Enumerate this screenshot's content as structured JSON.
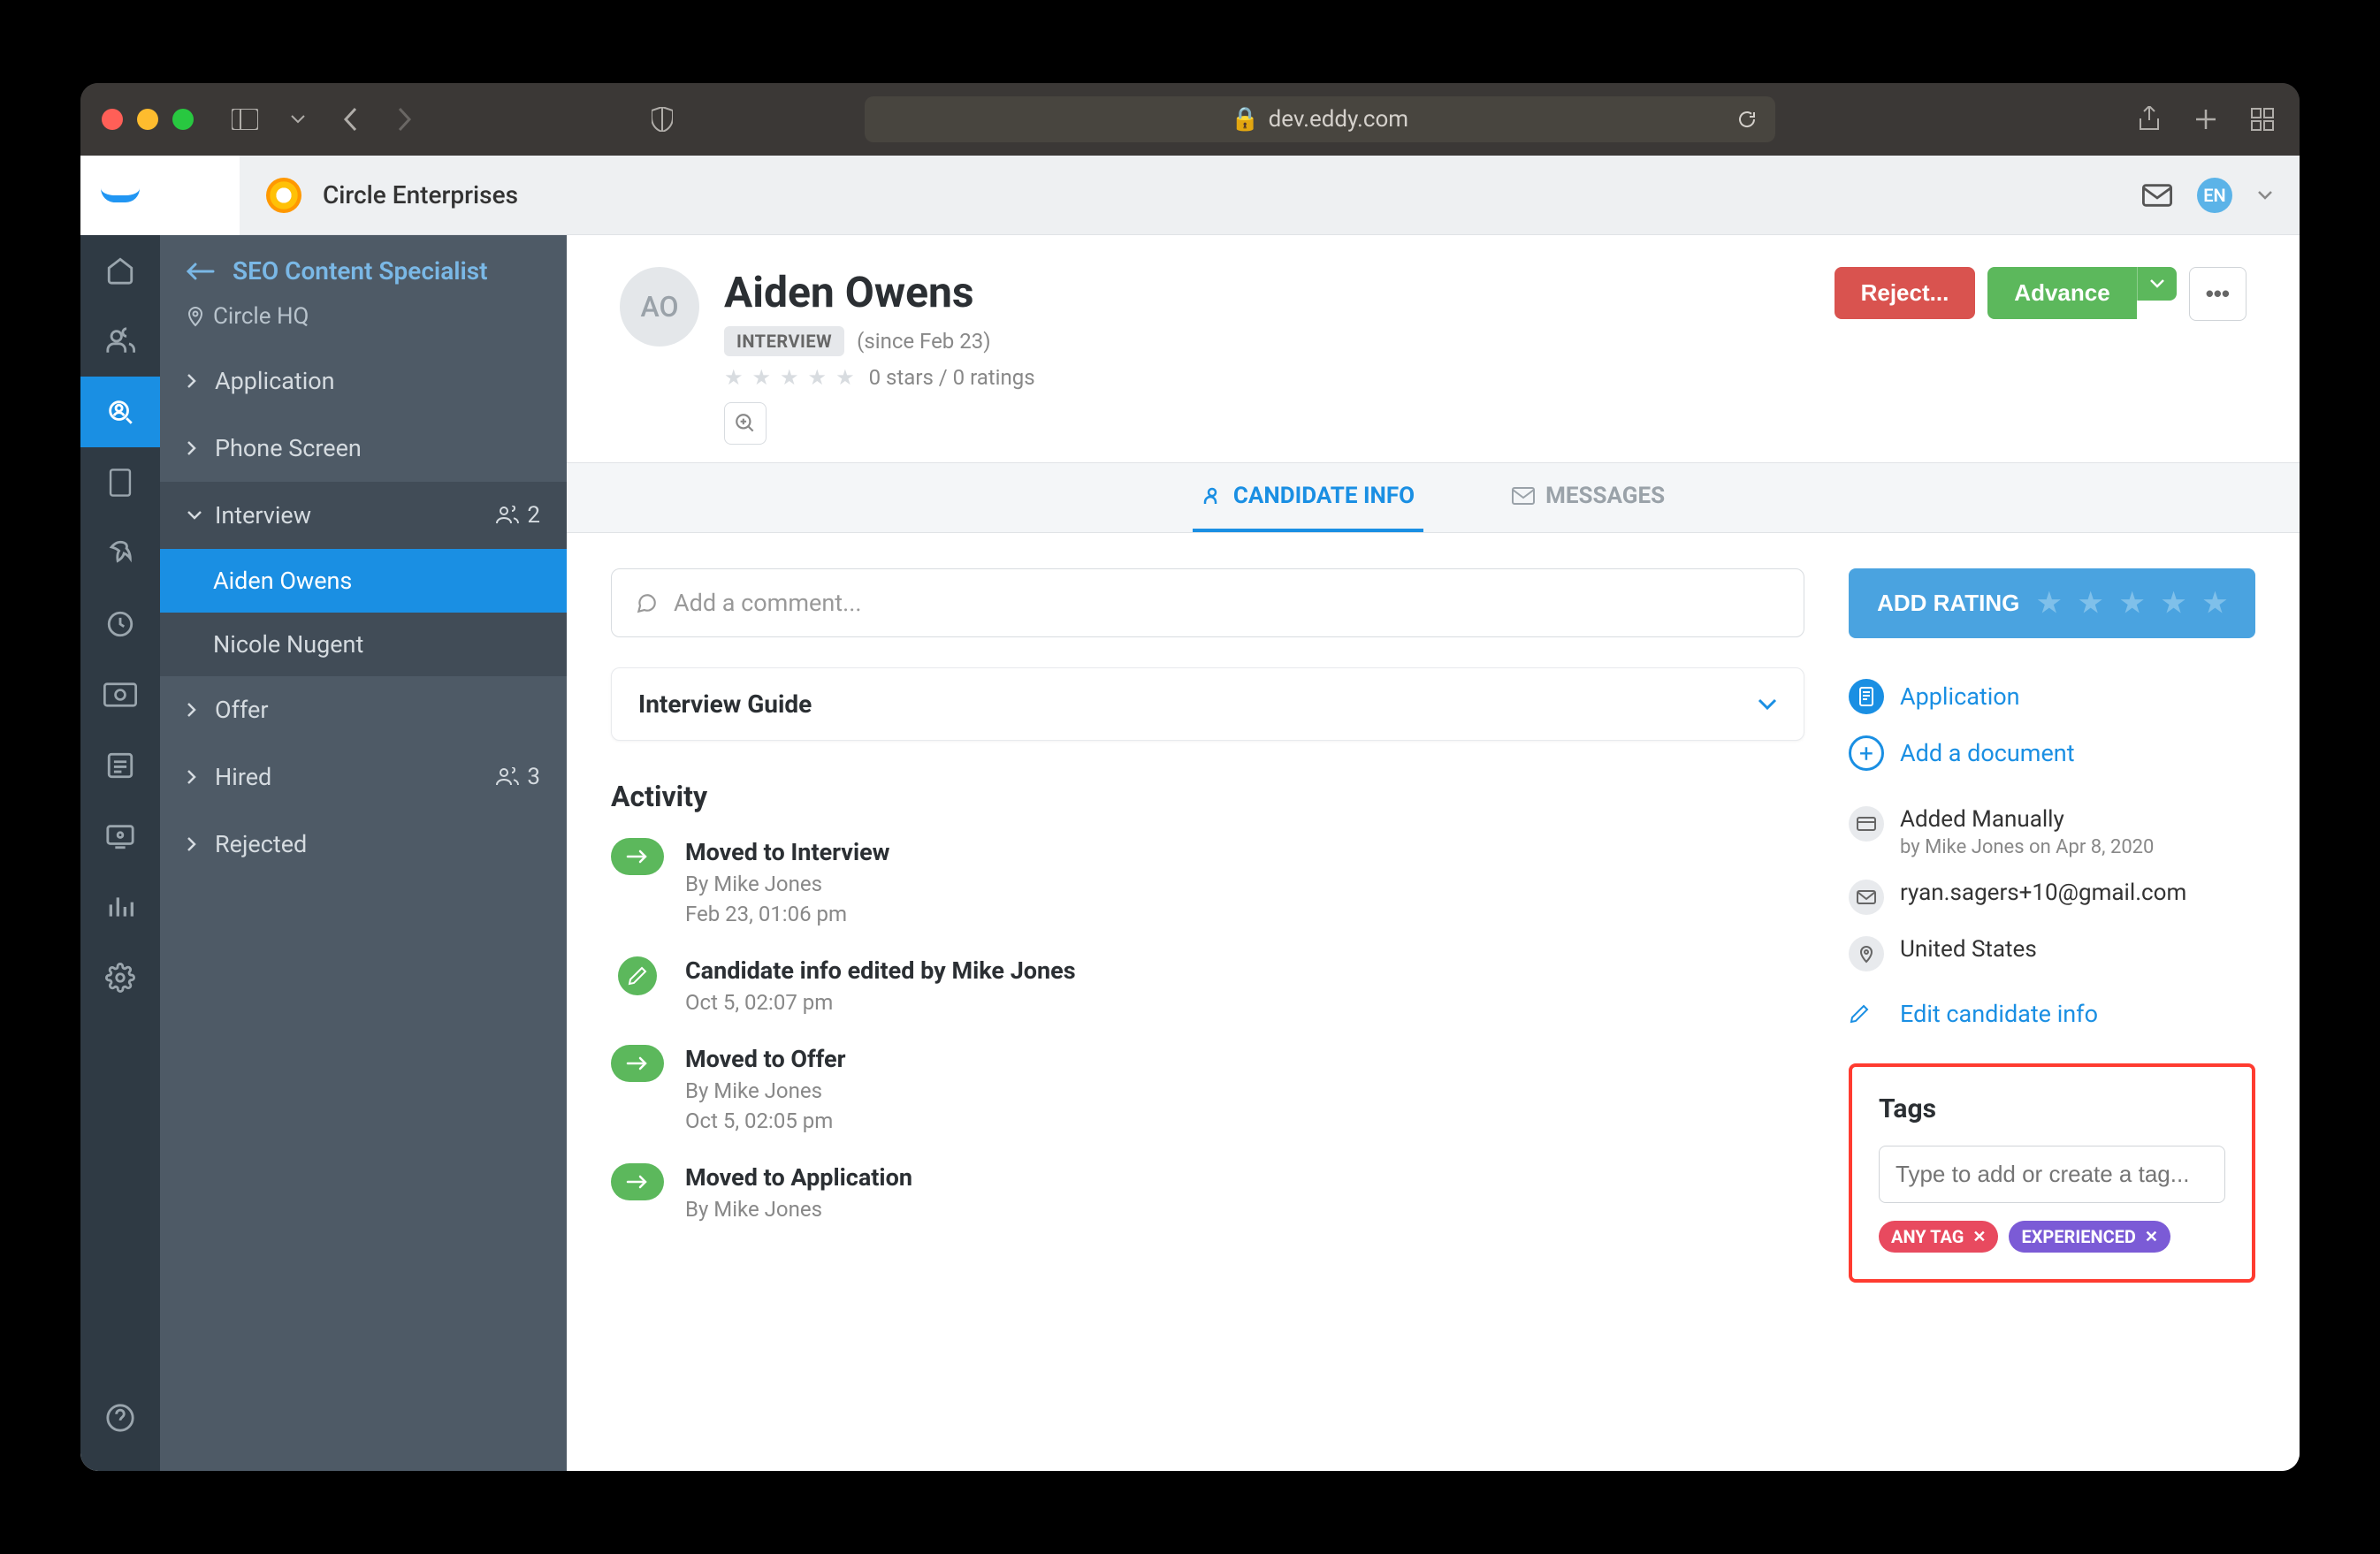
{
  "browser": {
    "url": "dev.eddy.com"
  },
  "topbar": {
    "org_name": "Circle Enterprises",
    "user_initials": "EN"
  },
  "sidepanel": {
    "title": "SEO Content Specialist",
    "location": "Circle HQ",
    "stages": {
      "application": "Application",
      "phone_screen": "Phone Screen",
      "interview": "Interview",
      "interview_count": "2",
      "offer": "Offer",
      "hired": "Hired",
      "hired_count": "3",
      "rejected": "Rejected"
    },
    "candidates": {
      "aiden": "Aiden Owens",
      "nicole": "Nicole Nugent"
    }
  },
  "profile": {
    "initials": "AO",
    "name": "Aiden Owens",
    "stage_badge": "INTERVIEW",
    "since": "(since Feb 23)",
    "rating_text": "0 stars / 0 ratings",
    "actions": {
      "reject": "Reject...",
      "advance": "Advance"
    }
  },
  "tabs": {
    "candidate_info": "CANDIDATE INFO",
    "messages": "MESSAGES"
  },
  "main": {
    "comment_placeholder": "Add a comment...",
    "interview_guide": "Interview Guide",
    "activity_title": "Activity",
    "activity": [
      {
        "title": "Moved to Interview",
        "by": "By Mike Jones",
        "time": "Feb 23, 01:06 pm",
        "icon": "arrow"
      },
      {
        "title": "Candidate info edited by Mike Jones",
        "by": "",
        "time": "Oct 5, 02:07 pm",
        "icon": "pencil"
      },
      {
        "title": "Moved to Offer",
        "by": "By Mike Jones",
        "time": "Oct 5, 02:05 pm",
        "icon": "arrow"
      },
      {
        "title": "Moved to Application",
        "by": "By Mike Jones",
        "time": "",
        "icon": "arrow"
      }
    ]
  },
  "side": {
    "add_rating": "ADD RATING",
    "application": "Application",
    "add_document": "Add a document",
    "added_manually": "Added Manually",
    "added_by": "by Mike Jones on Apr 8, 2020",
    "email": "ryan.sagers+10@gmail.com",
    "location": "United States",
    "edit_info": "Edit candidate info",
    "tags_title": "Tags",
    "tags_placeholder": "Type to add or create a tag...",
    "tag1": "ANY TAG",
    "tag2": "EXPERIENCED"
  }
}
